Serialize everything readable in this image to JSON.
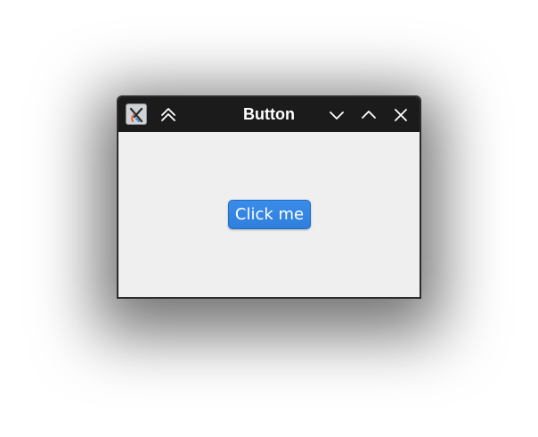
{
  "window": {
    "title": "Button",
    "app_icon": "xcode-like-app-icon",
    "controls": {
      "shade": "double-chevron-up-icon",
      "minimize": "chevron-down-icon",
      "maximize": "chevron-up-icon",
      "close": "close-icon"
    }
  },
  "content": {
    "button_label": "Click me"
  },
  "colors": {
    "titlebar": "#1b1b1b",
    "content_bg": "#efefef",
    "accent": "#2f7fde"
  }
}
